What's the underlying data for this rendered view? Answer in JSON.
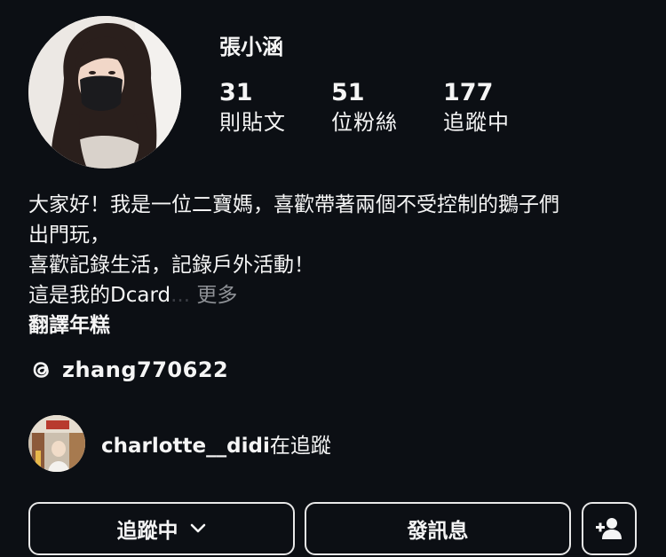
{
  "profile": {
    "username": "張小涵",
    "stats": [
      {
        "value": "31",
        "label": "則貼文"
      },
      {
        "value": "51",
        "label": "位粉絲"
      },
      {
        "value": "177",
        "label": "追蹤中"
      }
    ],
    "bio_lines": [
      "大家好！我是一位二寶媽，喜歡帶著兩個不受控制的鵝子們",
      "出門玩，",
      "喜歡記錄生活，記錄戶外活動！"
    ],
    "bio_last_line": "這是我的Dcard",
    "bio_ellipsis": "...",
    "more_label": "更多",
    "translate_label": "翻譯年糕"
  },
  "threads": {
    "handle": "zhang770622",
    "icon": "threads-icon"
  },
  "mutual": {
    "name": "charlotte__didi",
    "suffix": "在追蹤"
  },
  "buttons": {
    "following": "追蹤中",
    "message": "發訊息",
    "add_user_icon": "add-user-icon",
    "chevron_icon": "chevron-down-icon"
  },
  "colors": {
    "background": "#0c0f14",
    "text": "#f5f5f5",
    "muted": "#8e9196",
    "border": "#e8e8e8"
  }
}
